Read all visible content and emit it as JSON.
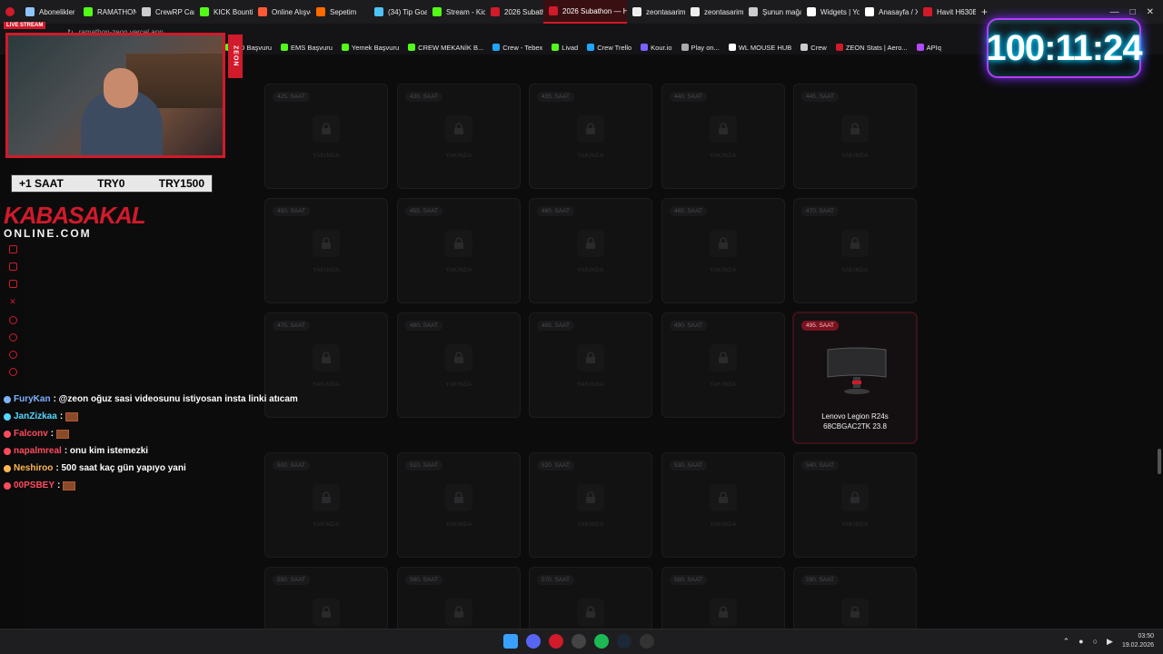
{
  "browser": {
    "tabs": [
      {
        "label": "Abonelikler",
        "color": "#8ec5ff"
      },
      {
        "label": "RAMATHON",
        "color": "#53fc18"
      },
      {
        "label": "CrewRP Car",
        "color": "#cccccc"
      },
      {
        "label": "KICK Bountie",
        "color": "#53fc18"
      },
      {
        "label": "Online Alışve",
        "color": "#ff5a36"
      },
      {
        "label": "Sepetim",
        "color": "#ff6a00"
      },
      {
        "label": "(34) Tip Goa",
        "color": "#4fc3f7"
      },
      {
        "label": "Stream - Kick",
        "color": "#53fc18"
      },
      {
        "label": "2026 Subath",
        "color": "#d11a2a"
      },
      {
        "label": "2026 Subathon — Hed",
        "color": "#d11a2a"
      },
      {
        "label": "zeontasarim",
        "color": "#eeeeee"
      },
      {
        "label": "zeontasarim",
        "color": "#eeeeee"
      },
      {
        "label": "Şunun mağa",
        "color": "#cccccc"
      },
      {
        "label": "Widgets | Yo",
        "color": "#ffffff"
      },
      {
        "label": "Anasayfa / X",
        "color": "#ffffff"
      },
      {
        "label": "Havit H630B",
        "color": "#d11a2a"
      }
    ],
    "active_tab_index": 9,
    "address": "ramathon-zeon.vercel.app",
    "bookmarks": [
      {
        "label": "PD Başvuru",
        "color": "#53fc18"
      },
      {
        "label": "EMS Başvuru",
        "color": "#53fc18"
      },
      {
        "label": "Yemek Başvuru",
        "color": "#53fc18"
      },
      {
        "label": "CREW MEKANİK B...",
        "color": "#53fc18"
      },
      {
        "label": "Crew - Tebex",
        "color": "#1ea7ff"
      },
      {
        "label": "Livad",
        "color": "#53fc18"
      },
      {
        "label": "Crew Trello",
        "color": "#1ea7ff"
      },
      {
        "label": "Kour.io",
        "color": "#7b61ff"
      },
      {
        "label": "Play on...",
        "color": "#aaaaaa"
      },
      {
        "label": "WL MOUSE HUB",
        "color": "#ffffff"
      },
      {
        "label": "Crew",
        "color": "#cccccc"
      },
      {
        "label": "ZEON Stats | Aero...",
        "color": "#d11a2a"
      },
      {
        "label": "APIq",
        "color": "#b04aff"
      }
    ]
  },
  "overlay": {
    "live_label": "LIVE STREAM",
    "vertical_logo": "ZEON",
    "donation_bar": {
      "left": "+1 SAAT",
      "middle": "TRY0",
      "right": "TRY1500"
    },
    "brand_top": "KABASAKAL",
    "brand_bottom": "ONLINE.COM",
    "timer": "100:11:24"
  },
  "chat": [
    {
      "user": "FuryKan",
      "user_color": "#7fb2ff",
      "text": ": @zeon oğuz sasi videosunu istiyosan insta linki atıcam",
      "emote": false
    },
    {
      "user": "JanZizkaa",
      "user_color": "#53d8ff",
      "text": ":",
      "emote": true
    },
    {
      "user": "Falconv",
      "user_color": "#ff4b5c",
      "text": ":",
      "emote": true
    },
    {
      "user": "napalmreal",
      "user_color": "#ff4b5c",
      "text": ": onu kim istemezki",
      "emote": false
    },
    {
      "user": "Neshiroo",
      "user_color": "#ffb84d",
      "text": ": 500 saat kaç gün yapıyo yani",
      "emote": false
    },
    {
      "user": "00PSBEY",
      "user_color": "#ff4b5c",
      "text": ":",
      "emote": true
    }
  ],
  "grid": {
    "locked_label": "YAKINDA",
    "rows": [
      [
        "425. SAAT",
        "430. SAAT",
        "435. SAAT",
        "440. SAAT",
        "445. SAAT"
      ],
      [
        "450. SAAT",
        "455. SAAT",
        "460. SAAT",
        "465. SAAT",
        "470. SAAT"
      ],
      [
        "475. SAAT",
        "480. SAAT",
        "485. SAAT",
        "490. SAAT",
        "495. SAAT"
      ],
      [
        "500. SAAT",
        "510. SAAT",
        "520. SAAT",
        "530. SAAT",
        "540. SAAT"
      ],
      [
        "550. SAAT",
        "560. SAAT",
        "570. SAAT",
        "580. SAAT",
        "590. SAAT"
      ]
    ],
    "unlocked": {
      "label": "495. SAAT",
      "prize_line1": "Lenovo Legion R24s",
      "prize_line2": "68CBGAC2TK 23.8"
    }
  },
  "taskbar": {
    "time": "03:50",
    "date": "19.02.2026",
    "apps": [
      {
        "name": "start",
        "color": "#3aa0ff"
      },
      {
        "name": "discord",
        "color": "#5865f2"
      },
      {
        "name": "browser",
        "color": "#d11a2a"
      },
      {
        "name": "obs",
        "color": "#444444"
      },
      {
        "name": "spotify",
        "color": "#1db954"
      },
      {
        "name": "steam",
        "color": "#1b2838"
      },
      {
        "name": "tool",
        "color": "#333333"
      }
    ]
  }
}
